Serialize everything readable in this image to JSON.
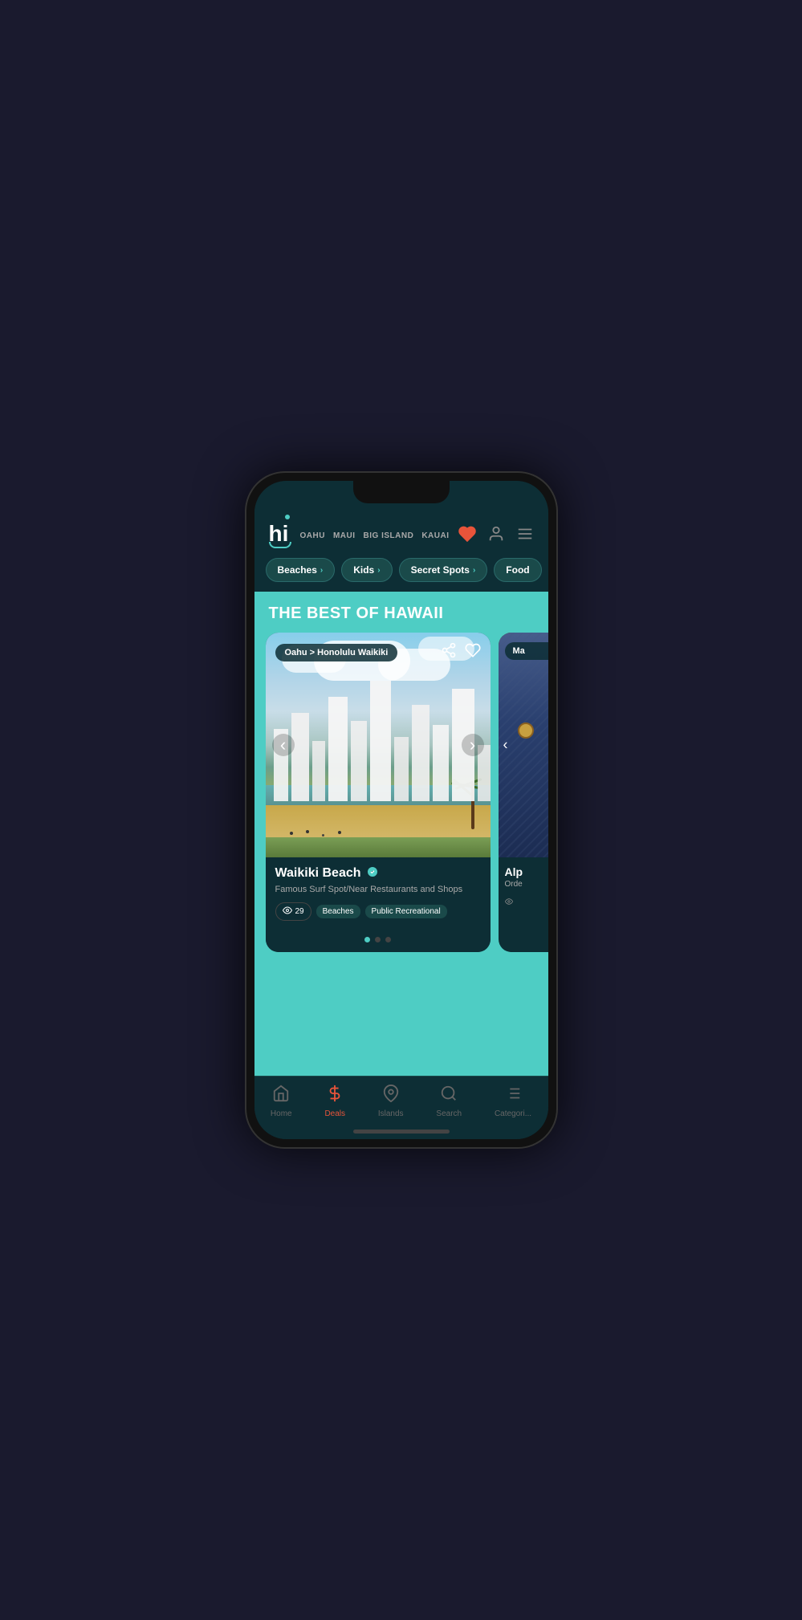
{
  "app": {
    "logo": "hi",
    "nav_links": [
      "OAHU",
      "MAUI",
      "BIG ISLAND",
      "KAUAI"
    ],
    "section_title": "THE BEST OF HAWAII"
  },
  "categories": [
    {
      "label": "Beaches",
      "has_arrow": true
    },
    {
      "label": "Kids",
      "has_arrow": true
    },
    {
      "label": "Secret Spots",
      "has_arrow": true
    },
    {
      "label": "Food",
      "has_arrow": false
    }
  ],
  "cards": [
    {
      "location": "Oahu > Honolulu Waikiki",
      "title": "Waikiki Beach",
      "verified": true,
      "description": "Famous Surf Spot/Near Restaurants and Shops",
      "views": 29,
      "tags": [
        "Beaches",
        "Public Recreational"
      ],
      "dots": [
        true,
        false,
        false
      ]
    },
    {
      "location": "Ma",
      "title": "Alp",
      "description": "Orde"
    }
  ],
  "bottom_nav": [
    {
      "label": "Home",
      "icon": "home",
      "active": false
    },
    {
      "label": "Deals",
      "icon": "dollar",
      "active": true
    },
    {
      "label": "Islands",
      "icon": "location",
      "active": false
    },
    {
      "label": "Search",
      "icon": "search",
      "active": false
    },
    {
      "label": "Categori...",
      "icon": "menu",
      "active": false
    }
  ],
  "colors": {
    "accent": "#4ecdc4",
    "active_nav": "#e8543a",
    "bg_dark": "#0d2e35",
    "bg_teal": "#4ecdc4"
  }
}
